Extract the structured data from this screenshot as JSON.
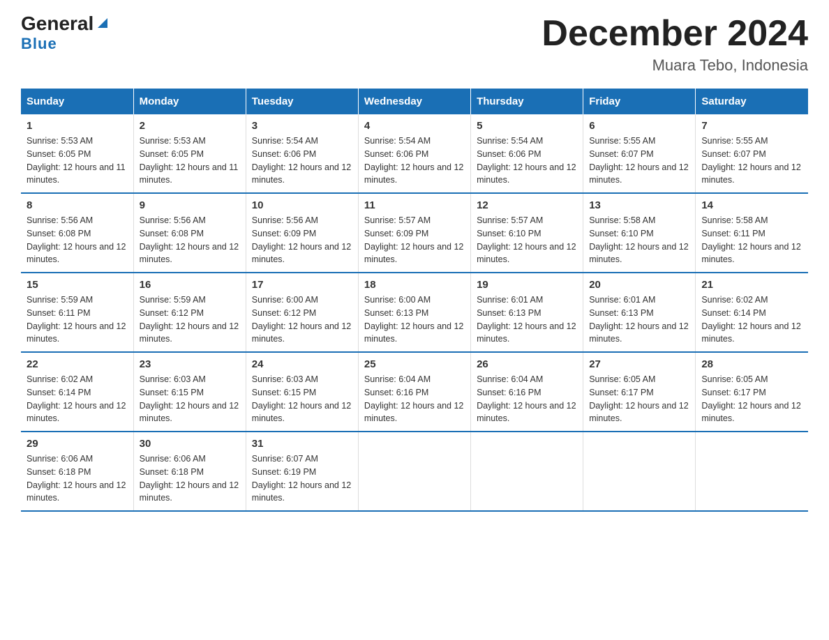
{
  "logo": {
    "general": "General",
    "blue": "Blue"
  },
  "title": "December 2024",
  "subtitle": "Muara Tebo, Indonesia",
  "weekdays": [
    "Sunday",
    "Monday",
    "Tuesday",
    "Wednesday",
    "Thursday",
    "Friday",
    "Saturday"
  ],
  "weeks": [
    [
      {
        "day": "1",
        "sunrise": "5:53 AM",
        "sunset": "6:05 PM",
        "daylight": "12 hours and 11 minutes."
      },
      {
        "day": "2",
        "sunrise": "5:53 AM",
        "sunset": "6:05 PM",
        "daylight": "12 hours and 11 minutes."
      },
      {
        "day": "3",
        "sunrise": "5:54 AM",
        "sunset": "6:06 PM",
        "daylight": "12 hours and 12 minutes."
      },
      {
        "day": "4",
        "sunrise": "5:54 AM",
        "sunset": "6:06 PM",
        "daylight": "12 hours and 12 minutes."
      },
      {
        "day": "5",
        "sunrise": "5:54 AM",
        "sunset": "6:06 PM",
        "daylight": "12 hours and 12 minutes."
      },
      {
        "day": "6",
        "sunrise": "5:55 AM",
        "sunset": "6:07 PM",
        "daylight": "12 hours and 12 minutes."
      },
      {
        "day": "7",
        "sunrise": "5:55 AM",
        "sunset": "6:07 PM",
        "daylight": "12 hours and 12 minutes."
      }
    ],
    [
      {
        "day": "8",
        "sunrise": "5:56 AM",
        "sunset": "6:08 PM",
        "daylight": "12 hours and 12 minutes."
      },
      {
        "day": "9",
        "sunrise": "5:56 AM",
        "sunset": "6:08 PM",
        "daylight": "12 hours and 12 minutes."
      },
      {
        "day": "10",
        "sunrise": "5:56 AM",
        "sunset": "6:09 PM",
        "daylight": "12 hours and 12 minutes."
      },
      {
        "day": "11",
        "sunrise": "5:57 AM",
        "sunset": "6:09 PM",
        "daylight": "12 hours and 12 minutes."
      },
      {
        "day": "12",
        "sunrise": "5:57 AM",
        "sunset": "6:10 PM",
        "daylight": "12 hours and 12 minutes."
      },
      {
        "day": "13",
        "sunrise": "5:58 AM",
        "sunset": "6:10 PM",
        "daylight": "12 hours and 12 minutes."
      },
      {
        "day": "14",
        "sunrise": "5:58 AM",
        "sunset": "6:11 PM",
        "daylight": "12 hours and 12 minutes."
      }
    ],
    [
      {
        "day": "15",
        "sunrise": "5:59 AM",
        "sunset": "6:11 PM",
        "daylight": "12 hours and 12 minutes."
      },
      {
        "day": "16",
        "sunrise": "5:59 AM",
        "sunset": "6:12 PM",
        "daylight": "12 hours and 12 minutes."
      },
      {
        "day": "17",
        "sunrise": "6:00 AM",
        "sunset": "6:12 PM",
        "daylight": "12 hours and 12 minutes."
      },
      {
        "day": "18",
        "sunrise": "6:00 AM",
        "sunset": "6:13 PM",
        "daylight": "12 hours and 12 minutes."
      },
      {
        "day": "19",
        "sunrise": "6:01 AM",
        "sunset": "6:13 PM",
        "daylight": "12 hours and 12 minutes."
      },
      {
        "day": "20",
        "sunrise": "6:01 AM",
        "sunset": "6:13 PM",
        "daylight": "12 hours and 12 minutes."
      },
      {
        "day": "21",
        "sunrise": "6:02 AM",
        "sunset": "6:14 PM",
        "daylight": "12 hours and 12 minutes."
      }
    ],
    [
      {
        "day": "22",
        "sunrise": "6:02 AM",
        "sunset": "6:14 PM",
        "daylight": "12 hours and 12 minutes."
      },
      {
        "day": "23",
        "sunrise": "6:03 AM",
        "sunset": "6:15 PM",
        "daylight": "12 hours and 12 minutes."
      },
      {
        "day": "24",
        "sunrise": "6:03 AM",
        "sunset": "6:15 PM",
        "daylight": "12 hours and 12 minutes."
      },
      {
        "day": "25",
        "sunrise": "6:04 AM",
        "sunset": "6:16 PM",
        "daylight": "12 hours and 12 minutes."
      },
      {
        "day": "26",
        "sunrise": "6:04 AM",
        "sunset": "6:16 PM",
        "daylight": "12 hours and 12 minutes."
      },
      {
        "day": "27",
        "sunrise": "6:05 AM",
        "sunset": "6:17 PM",
        "daylight": "12 hours and 12 minutes."
      },
      {
        "day": "28",
        "sunrise": "6:05 AM",
        "sunset": "6:17 PM",
        "daylight": "12 hours and 12 minutes."
      }
    ],
    [
      {
        "day": "29",
        "sunrise": "6:06 AM",
        "sunset": "6:18 PM",
        "daylight": "12 hours and 12 minutes."
      },
      {
        "day": "30",
        "sunrise": "6:06 AM",
        "sunset": "6:18 PM",
        "daylight": "12 hours and 12 minutes."
      },
      {
        "day": "31",
        "sunrise": "6:07 AM",
        "sunset": "6:19 PM",
        "daylight": "12 hours and 12 minutes."
      },
      {
        "day": "",
        "sunrise": "",
        "sunset": "",
        "daylight": ""
      },
      {
        "day": "",
        "sunrise": "",
        "sunset": "",
        "daylight": ""
      },
      {
        "day": "",
        "sunrise": "",
        "sunset": "",
        "daylight": ""
      },
      {
        "day": "",
        "sunrise": "",
        "sunset": "",
        "daylight": ""
      }
    ]
  ],
  "labels": {
    "sunrise": "Sunrise:",
    "sunset": "Sunset:",
    "daylight": "Daylight:"
  }
}
